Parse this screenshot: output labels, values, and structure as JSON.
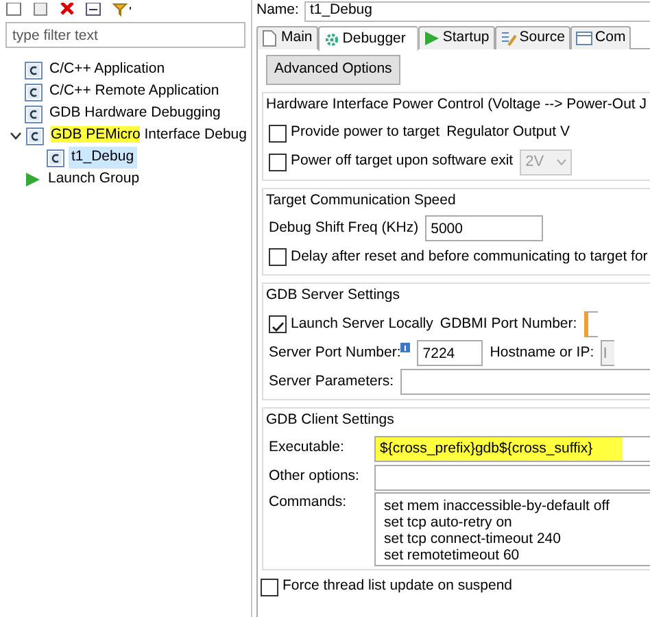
{
  "filter": {
    "placeholder": "type filter text"
  },
  "tree": [
    {
      "kind": "config",
      "selected": false,
      "label": [
        {
          "text": "C/C++ Application",
          "highlighted": false
        }
      ]
    },
    {
      "kind": "config",
      "selected": false,
      "label": [
        {
          "text": "C/C++ Remote Application",
          "highlighted": false
        }
      ]
    },
    {
      "kind": "config",
      "selected": false,
      "label": [
        {
          "text": "GDB Hardware Debugging",
          "highlighted": false
        }
      ]
    },
    {
      "kind": "config",
      "selected": false,
      "expanded": true,
      "label": [
        {
          "text": "GDB PEMicro",
          "highlighted": true
        },
        {
          "text": " Interface Debug",
          "highlighted": false
        }
      ],
      "children": [
        {
          "kind": "config",
          "selected": true,
          "label": [
            {
              "text": "t1_Debug",
              "highlighted": false
            }
          ]
        }
      ]
    },
    {
      "kind": "group",
      "selected": false,
      "label": [
        {
          "text": "Launch Group",
          "highlighted": false
        }
      ]
    }
  ],
  "name": {
    "label": "Name:",
    "value": "t1_Debug"
  },
  "tabs": [
    {
      "kind": "document",
      "label": "Main",
      "selected": false
    },
    {
      "kind": "gear",
      "label": "Debugger",
      "selected": true
    },
    {
      "kind": "play",
      "label": "Startup",
      "selected": false
    },
    {
      "kind": "source",
      "label": "Source",
      "selected": false
    },
    {
      "kind": "table",
      "label": "Com",
      "selected": false
    }
  ],
  "advanced_button": "Advanced Options",
  "groups": [
    {
      "title": "Hardware Interface Power Control (Voltage --> Power-Out J",
      "rows": [
        [
          {
            "kind": "checkbox",
            "label": "Provide power to target",
            "checked": false
          },
          {
            "kind": "label",
            "text": "Regulator Output V"
          }
        ],
        [
          {
            "kind": "checkbox",
            "label": "Power off target upon software exit",
            "checked": false
          },
          {
            "kind": "select",
            "value": "2V",
            "disabled": true
          }
        ]
      ]
    },
    {
      "title": "Target Communication Speed",
      "rows": [
        [
          {
            "kind": "label",
            "text": "Debug Shift Freq (KHz)"
          },
          {
            "kind": "input",
            "value": "5000"
          }
        ],
        [
          {
            "kind": "checkbox",
            "label": "Delay after reset and before communicating to target for",
            "checked": false
          }
        ]
      ]
    },
    {
      "title": "GDB Server Settings",
      "rows": [
        [
          {
            "kind": "checkbox",
            "label": "Launch Server Locally",
            "checked": true
          },
          {
            "kind": "label",
            "text": "GDBMI Port Number:"
          },
          {
            "kind": "stub",
            "disabled": false
          }
        ],
        [
          {
            "kind": "info-label",
            "text": "Server Port Number:"
          },
          {
            "kind": "input",
            "value": "7224"
          },
          {
            "kind": "label",
            "text": "Hostname or IP:"
          },
          {
            "kind": "stub",
            "value": "l",
            "disabled": true
          }
        ],
        [
          {
            "kind": "label",
            "text": "Server Parameters:"
          },
          {
            "kind": "wide"
          }
        ]
      ]
    },
    {
      "title": "GDB Client Settings",
      "rows": [
        [
          {
            "kind": "field-label",
            "text": "Executable:"
          },
          {
            "kind": "wide",
            "value": "${cross_prefix}gdb${cross_suffix}",
            "highlighted": true
          }
        ],
        [
          {
            "kind": "field-label",
            "text": "Other options:"
          },
          {
            "kind": "wide"
          }
        ],
        [
          {
            "kind": "field-label",
            "text": "Commands:"
          },
          {
            "kind": "textarea",
            "lines": [
              "set mem inaccessible-by-default off",
              "set tcp auto-retry on",
              "set tcp connect-timeout 240",
              "set remotetimeout 60"
            ]
          }
        ]
      ]
    }
  ],
  "bottom_checkbox": {
    "label": "Force thread list update on suspend",
    "checked": false
  }
}
